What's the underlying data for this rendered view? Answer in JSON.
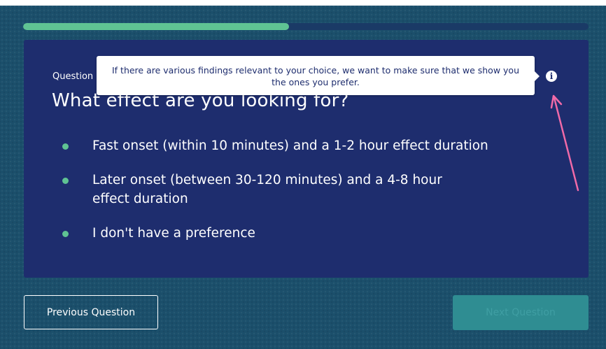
{
  "progress": {
    "fraction": 0.47
  },
  "question": {
    "label": "Question",
    "title": "What effect are you looking for?"
  },
  "options": [
    {
      "label": "Fast onset (within 10 minutes) and a 1-2 hour effect duration"
    },
    {
      "label": "Later onset (between 30-120 minutes) and a 4-8 hour effect duration"
    },
    {
      "label": "I don't have a preference"
    }
  ],
  "tooltip": {
    "text": "If there are various findings relevant to your choice, we want to make sure that we show you the ones you prefer."
  },
  "info_icon": {
    "icon": "info-icon",
    "glyph": "i"
  },
  "buttons": {
    "previous_label": "Previous Question",
    "next_label": "Next Question"
  },
  "colors": {
    "background": "#1b4f6b",
    "card": "#1e2d6e",
    "accent_green": "#5fc393",
    "annotation_arrow": "#f06aa8",
    "next_disabled": "#2f8d92"
  }
}
